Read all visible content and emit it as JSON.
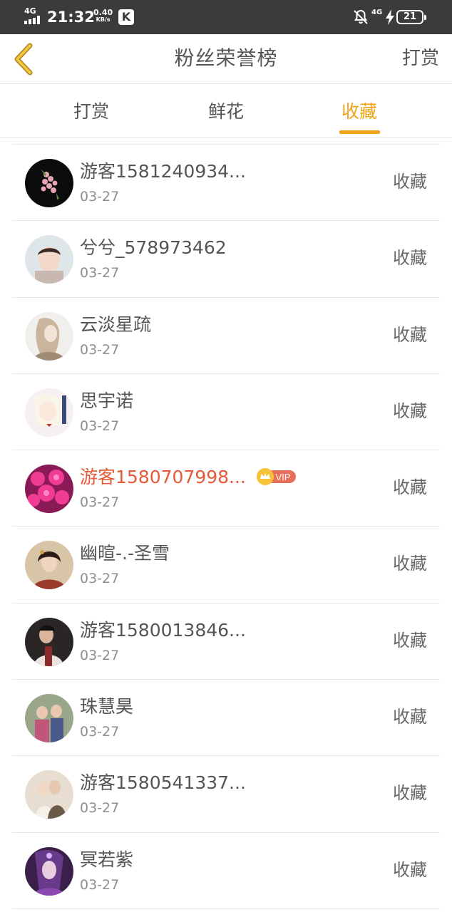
{
  "status_bar": {
    "network": "4G",
    "time": "21:32",
    "speed_value": "0.40",
    "speed_unit": "KB/s",
    "app_badge": "K",
    "network_right": "4G",
    "battery": "21"
  },
  "header": {
    "title": "粉丝荣誉榜",
    "action_label": "打赏"
  },
  "tabs": [
    {
      "label": "打赏",
      "active": false
    },
    {
      "label": "鲜花",
      "active": false
    },
    {
      "label": "收藏",
      "active": true
    }
  ],
  "accent_color": "#f0a31a",
  "vip_color": "#e45b3a",
  "vip_badge_text": "VIP",
  "fans": [
    {
      "name": "游客1581240934...",
      "date": "03-27",
      "action": "收藏",
      "vip": false,
      "avatar": "flower-pink-on-black"
    },
    {
      "name": "兮兮_578973462",
      "date": "03-27",
      "action": "收藏",
      "vip": false,
      "avatar": "child-portrait"
    },
    {
      "name": "云淡星疏",
      "date": "03-27",
      "action": "收藏",
      "vip": false,
      "avatar": "sketch-woman"
    },
    {
      "name": "思宇诺",
      "date": "03-27",
      "action": "收藏",
      "vip": false,
      "avatar": "anime-girl"
    },
    {
      "name": "游客1580707998...",
      "date": "03-27",
      "action": "收藏",
      "vip": true,
      "avatar": "pink-flowers"
    },
    {
      "name": "幽暄-.-圣雪",
      "date": "03-27",
      "action": "收藏",
      "vip": false,
      "avatar": "costume-woman"
    },
    {
      "name": "游客1580013846...",
      "date": "03-27",
      "action": "收藏",
      "vip": false,
      "avatar": "man-dark"
    },
    {
      "name": "珠慧昊",
      "date": "03-27",
      "action": "收藏",
      "vip": false,
      "avatar": "family-photo"
    },
    {
      "name": "游客1580541337...",
      "date": "03-27",
      "action": "收藏",
      "vip": false,
      "avatar": "couple-photo"
    },
    {
      "name": "冥若紫",
      "date": "03-27",
      "action": "收藏",
      "vip": false,
      "avatar": "purple-fantasy"
    }
  ]
}
